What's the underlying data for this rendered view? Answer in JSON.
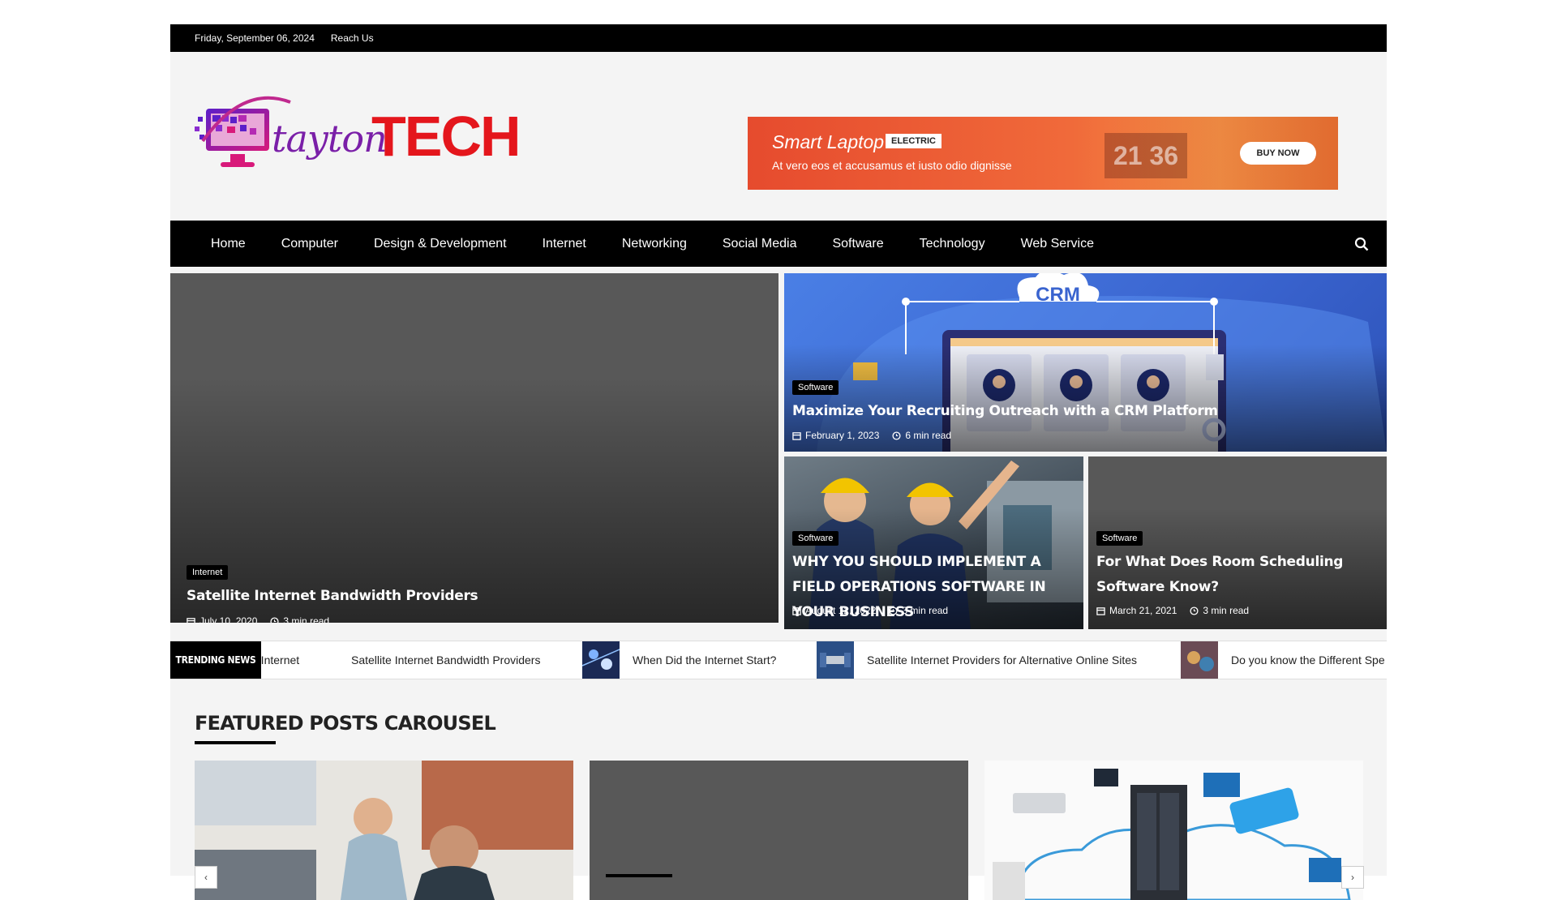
{
  "topbar": {
    "date": "Friday, September 06, 2024",
    "reach": "Reach Us"
  },
  "logo": {
    "italic": "tayton",
    "bold": "TECH"
  },
  "ad": {
    "title": "Smart Laptop",
    "badge": "ELECTRIC",
    "subtitle": "At vero eos et accusamus et iusto odio dignisse",
    "clock": "21 36",
    "button": "BUY NOW"
  },
  "nav": {
    "items": [
      "Home",
      "Computer",
      "Design & Development",
      "Internet",
      "Networking",
      "Social Media",
      "Software",
      "Technology",
      "Web Service"
    ]
  },
  "hero": {
    "main": {
      "category": "Internet",
      "title": "Satellite Internet Bandwidth Providers",
      "date": "July 10, 2020",
      "read": "3 min read"
    },
    "top_right": {
      "category": "Software",
      "title": "Maximize Your Recruiting Outreach with a CRM Platform",
      "date": "February 1, 2023",
      "read": "6 min read",
      "crm_label": "CRM"
    },
    "bottom_left": {
      "category": "Software",
      "title": "WHY YOU SHOULD IMPLEMENT A FIELD OPERATIONS SOFTWARE IN YOUR BUSINESS",
      "date": "August 12, 2022",
      "read": "3 min read"
    },
    "bottom_right": {
      "category": "Software",
      "title": "For What Does Room Scheduling Software Know?",
      "date": "March 21, 2021",
      "read": "3 min read"
    }
  },
  "trending": {
    "label": "TRENDING NEWS",
    "items": [
      "e Internet",
      "Satellite Internet Bandwidth Providers",
      "When Did the Internet Start?",
      "Satellite Internet Providers for Alternative Online Sites",
      "Do you know the Different Spe"
    ]
  },
  "featured": {
    "title": "FEATURED POSTS CAROUSEL"
  },
  "colors": {
    "accent_red": "#e4161c",
    "logo_purple": "#7a1fa8",
    "nav_bg": "#000000",
    "ad_orange": "#f06a3a",
    "crm_blue": "#3d6fd8"
  }
}
